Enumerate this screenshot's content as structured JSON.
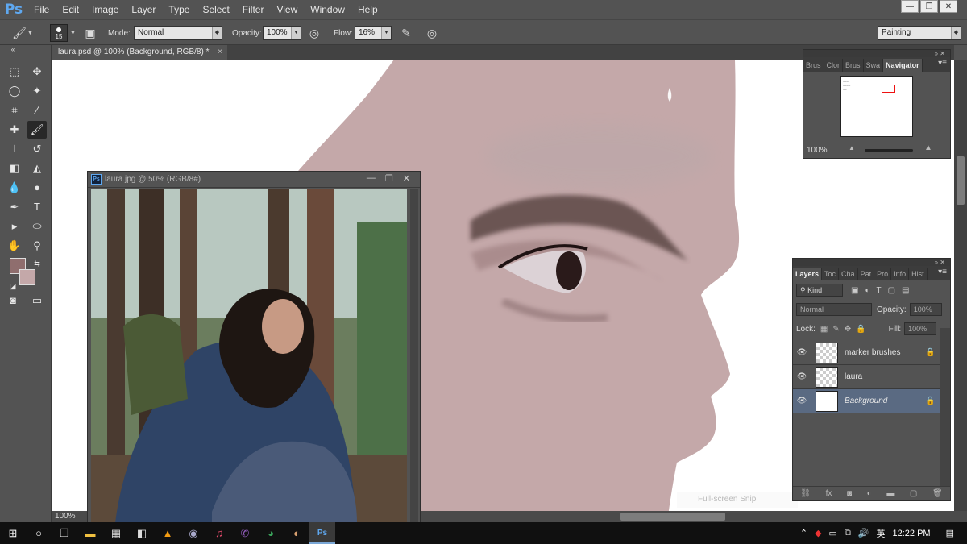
{
  "app": {
    "logo": "Ps"
  },
  "menu": [
    "File",
    "Edit",
    "Image",
    "Layer",
    "Type",
    "Select",
    "Filter",
    "View",
    "Window",
    "Help"
  ],
  "window_controls": {
    "minimize": "—",
    "restore": "❐",
    "close": "✕"
  },
  "options": {
    "brush_size": "15",
    "mode_label": "Mode:",
    "mode_value": "Normal",
    "opacity_label": "Opacity:",
    "opacity_value": "100%",
    "flow_label": "Flow:",
    "flow_value": "16%"
  },
  "workspace": "Painting",
  "document_tab": {
    "title": "laura.psd @ 100% (Background, RGB/8) *",
    "close": "×"
  },
  "canvas": {
    "zoom": "100%",
    "background": "#ffffff",
    "skin": "#c4a8a9"
  },
  "colors": {
    "foreground": "#8f6e6e",
    "background": "#c4a8a9"
  },
  "reference_window": {
    "title": "laura.jpg @ 50% (RGB/8#)"
  },
  "overlay": {
    "snip_text": "Full-screen Snip"
  },
  "navigator": {
    "tabs": [
      "Brus",
      "Clor",
      "Brus",
      "Swa",
      "Navigator"
    ],
    "zoom": "100%"
  },
  "layers": {
    "tabs": [
      "Layers",
      "Toc",
      "Cha",
      "Pat",
      "Pro",
      "Info",
      "Hist"
    ],
    "kind_label": "Kind",
    "blend_mode": "Normal",
    "opacity_label": "Opacity:",
    "opacity_value": "100%",
    "lock_label": "Lock:",
    "fill_label": "Fill:",
    "fill_value": "100%",
    "items": [
      {
        "name": "marker brushes",
        "locked": true
      },
      {
        "name": "laura",
        "locked": false
      },
      {
        "name": "Background",
        "locked": true
      }
    ]
  },
  "taskbar": {
    "time": "12:22 PM"
  }
}
